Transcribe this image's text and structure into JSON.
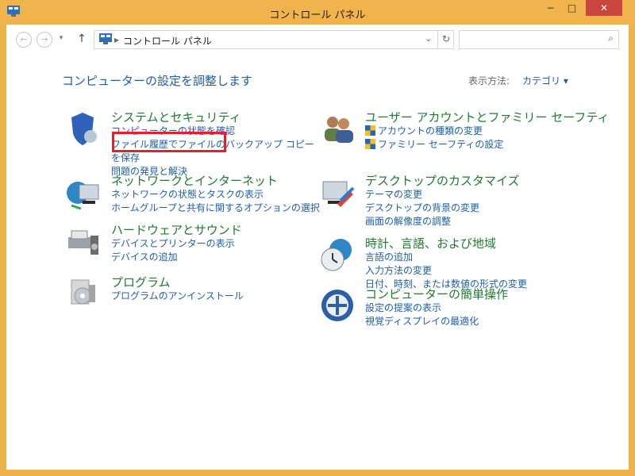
{
  "window": {
    "title": "コントロール パネル",
    "controls": {
      "minimize": "−",
      "maximize": "□",
      "close": "✕"
    }
  },
  "nav": {
    "back_icon": "back-arrow-icon",
    "forward_icon": "forward-arrow-icon",
    "up_icon": "up-arrow-icon",
    "breadcrumb": "コントロール パネル",
    "search_placeholder": ""
  },
  "main": {
    "heading": "コンピューターの設定を調整します",
    "view_label": "表示方法:",
    "view_value": "カテゴリ"
  },
  "categories": {
    "left": [
      {
        "title": "システムとセキュリティ",
        "links": [
          "コンピューターの状態を確認",
          "ファイル履歴でファイルのバックアップ コピーを保存",
          "問題の発見と解決"
        ]
      },
      {
        "title": "ネットワークとインターネット",
        "links": [
          "ネットワークの状態とタスクの表示",
          "ホームグループと共有に関するオプションの選択"
        ]
      },
      {
        "title": "ハードウェアとサウンド",
        "links": [
          "デバイスとプリンターの表示",
          "デバイスの追加"
        ]
      },
      {
        "title": "プログラム",
        "links": [
          "プログラムのアンインストール"
        ]
      }
    ],
    "right": [
      {
        "title": "ユーザー アカウントとファミリー セーフティ",
        "links": [
          "アカウントの種類の変更",
          "ファミリー セーフティの設定"
        ]
      },
      {
        "title": "デスクトップのカスタマイズ",
        "links": [
          "テーマの変更",
          "デスクトップの背景の変更",
          "画面の解像度の調整"
        ]
      },
      {
        "title": "時計、言語、および地域",
        "links": [
          "言語の追加",
          "入力方法の変更",
          "日付、時刻、または数値の形式の変更"
        ]
      },
      {
        "title": "コンピューターの簡単操作",
        "links": [
          "設定の提案の表示",
          "視覚ディスプレイの最適化"
        ]
      }
    ]
  }
}
